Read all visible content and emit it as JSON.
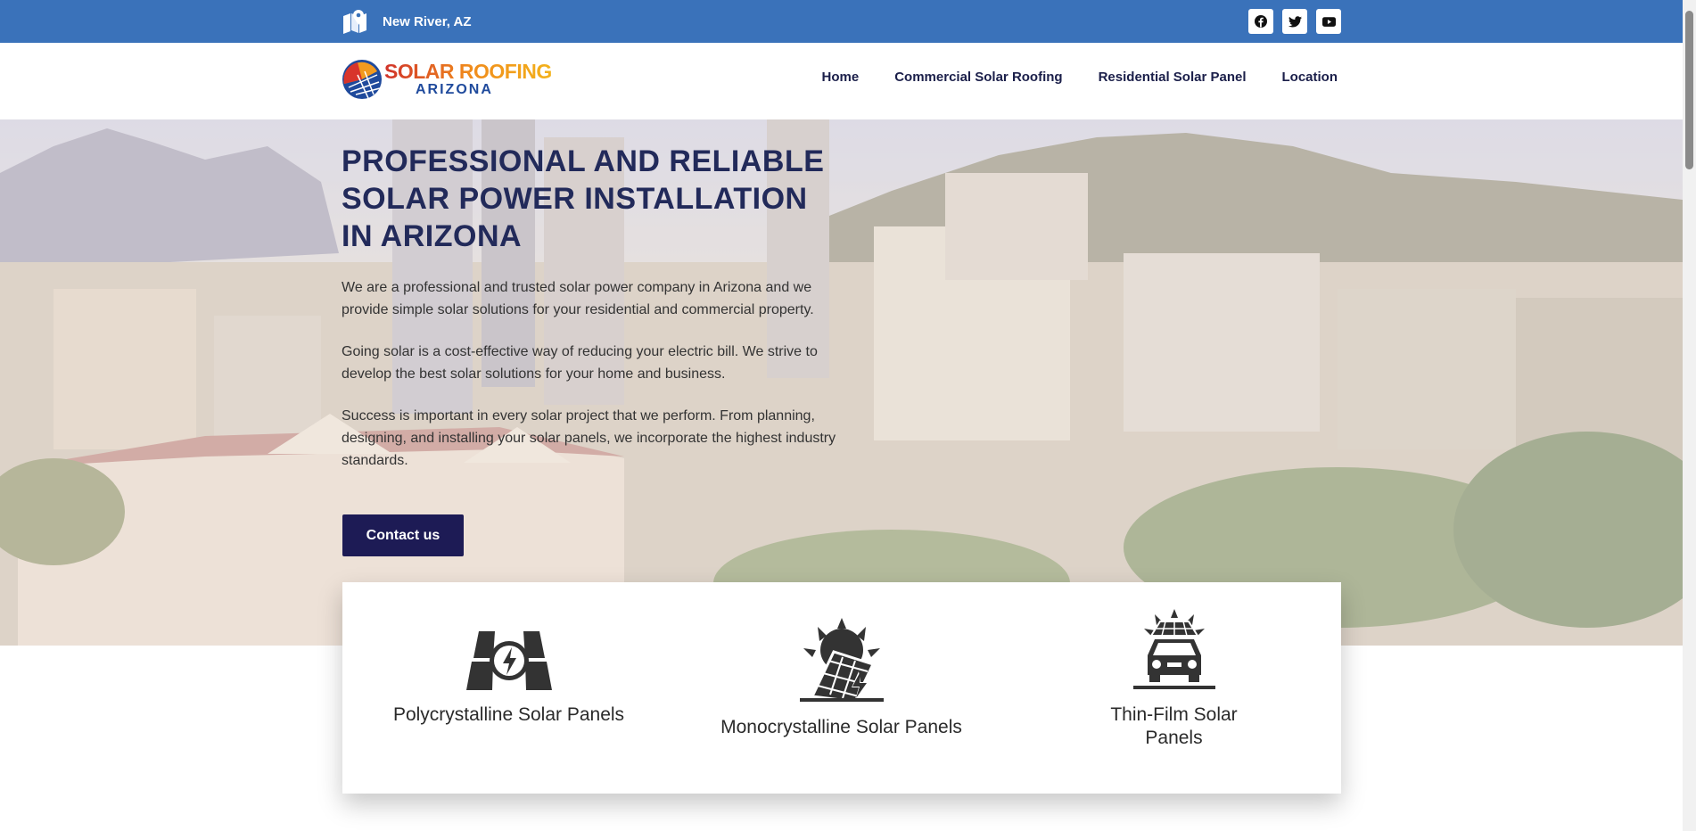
{
  "topbar": {
    "location": "New River, AZ",
    "location_icon": "map-icon",
    "social": [
      "facebook-icon",
      "twitter-icon",
      "youtube-icon"
    ],
    "bg_color": "#3a72ba"
  },
  "header": {
    "logo": {
      "line1": "SOLAR ROOFING",
      "line2": "ARIZONA"
    },
    "nav": [
      "Home",
      "Commercial Solar Roofing",
      "Residential Solar Panel",
      "Location"
    ]
  },
  "hero": {
    "title": "PROFESSIONAL AND RELIABLE SOLAR POWER INSTALLATION IN ARIZONA",
    "paragraphs": [
      "We are a professional and trusted solar power company in Arizona and we provide simple solar solutions for your residential and commercial property.",
      "Going solar is a cost-effective way of reducing your electric bill. We strive to develop the best solar solutions for your home and business.",
      "Success is important in every solar project that we perform. From planning, designing, and installing your solar panels, we incorporate the highest industry standards."
    ],
    "cta_label": "Contact us",
    "cta_color": "#1d1b55",
    "title_color": "#222a5a"
  },
  "cards": [
    {
      "title": "Polycrystalline Solar Panels",
      "icon": "solar-panel-bolt-icon"
    },
    {
      "title": "Monocrystalline Solar Panels",
      "icon": "sun-solar-panel-icon"
    },
    {
      "title": "Thin-Film Solar Panels",
      "icon": "solar-car-icon"
    }
  ]
}
